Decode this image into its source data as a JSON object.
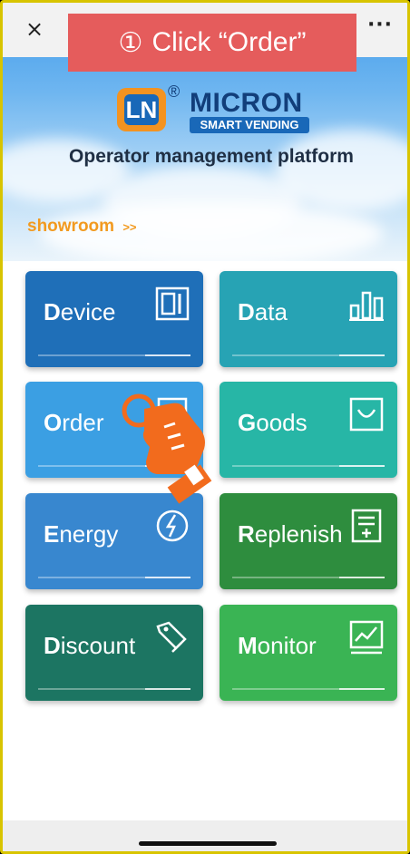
{
  "callout": {
    "number": "①",
    "text": "Click “Order”"
  },
  "topbar": {
    "close_glyph": "×",
    "more_glyph": "···"
  },
  "logo": {
    "mark": "LN",
    "registered": "®",
    "brand": "MICRON",
    "sub": "SMART VENDING"
  },
  "header": {
    "title": "Operator management platform"
  },
  "showroom": {
    "label": "showroom",
    "arrow": ">>"
  },
  "tiles": [
    {
      "key": "device",
      "first": "D",
      "rest": "evice",
      "icon": "device-icon",
      "color": "#1f6fb8"
    },
    {
      "key": "data",
      "first": "D",
      "rest": "ata",
      "icon": "bar-chart-icon",
      "color": "#27a3b4"
    },
    {
      "key": "order",
      "first": "O",
      "rest": "rder",
      "icon": "document-icon",
      "color": "#3b9fe3"
    },
    {
      "key": "goods",
      "first": "G",
      "rest": "oods",
      "icon": "smile-box-icon",
      "color": "#27b6a6"
    },
    {
      "key": "energy",
      "first": "E",
      "rest": "nergy",
      "icon": "power-icon",
      "color": "#3887cf"
    },
    {
      "key": "replenish",
      "first": "R",
      "rest": "eplenish",
      "icon": "add-list-icon",
      "color": "#2e8d3e"
    },
    {
      "key": "discount",
      "first": "D",
      "rest": "iscount",
      "icon": "tag-icon",
      "color": "#1c7562"
    },
    {
      "key": "monitor",
      "first": "M",
      "rest": "onitor",
      "icon": "monitor-chart-icon",
      "color": "#3ab454"
    }
  ],
  "pointer": {
    "icon": "pointing-hand-icon",
    "color": "#f26b1d"
  }
}
